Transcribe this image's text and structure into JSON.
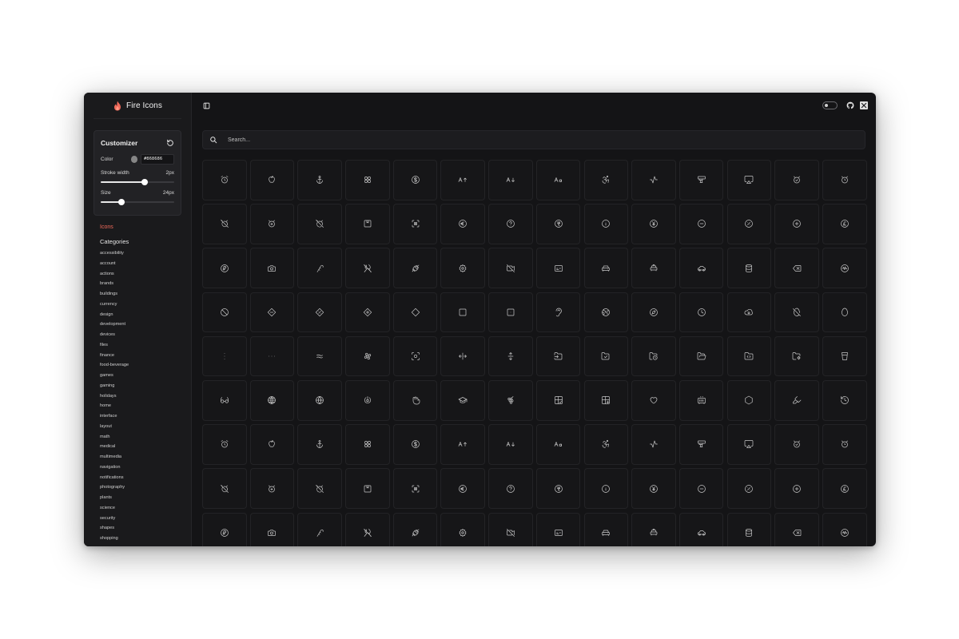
{
  "brand": {
    "name": "Fire Icons",
    "accent": "#f06a5b"
  },
  "customizer": {
    "title": "Customizer",
    "color_label": "Color",
    "color_value": "#868686",
    "stroke_label": "Stroke width",
    "stroke_value": "2px",
    "stroke_fraction": 0.6,
    "size_label": "Size",
    "size_value": "24px",
    "size_fraction": 0.28
  },
  "nav": {
    "icons_label": "Icons",
    "categories_label": "Categories",
    "categories": [
      "accessibility",
      "account",
      "actions",
      "brands",
      "buildings",
      "currency",
      "design",
      "development",
      "devices",
      "files",
      "finance",
      "food-beverage",
      "games",
      "gaming",
      "holidays",
      "home",
      "interface",
      "layout",
      "math",
      "medical",
      "multimedia",
      "navigation",
      "notifications",
      "photography",
      "plants",
      "science",
      "security",
      "shapes",
      "shopping"
    ]
  },
  "search": {
    "placeholder": "Search..."
  },
  "icon_rows": [
    [
      "alarm-clock-icon",
      "apple-icon",
      "anchor-icon",
      "four-circles-icon",
      "dollar-circle-icon",
      "a-arrow-up-icon",
      "a-arrow-down-icon",
      "a-lowercase-icon",
      "accessibility-icon",
      "activity-icon",
      "stamp-icon",
      "airplay-icon",
      "alarm-check-icon",
      "alarm-clock-alt-icon"
    ],
    [
      "alarm-off-icon",
      "alarm-plus-icon",
      "alarm-clock-off-icon",
      "square-bookmark-icon",
      "focus-icon",
      "euro-circle-icon",
      "help-circle-icon",
      "rupee-circle-icon",
      "info-circle-icon",
      "yen-circle-icon",
      "minus-circle-icon",
      "percent-circle-icon",
      "plus-circle-icon",
      "pound-circle-icon"
    ],
    [
      "ruble-circle-icon",
      "camera-icon",
      "candy-cane-icon",
      "cutlery-off-icon",
      "candy-icon",
      "sun-badge-icon",
      "video-off-icon",
      "card-icon",
      "car-front-icon",
      "car-taxi-icon",
      "car-side-icon",
      "database-icon",
      "delete-icon",
      "audio-circle-icon"
    ],
    [
      "ban-icon",
      "diamond-minus-icon",
      "diamond-percent-icon",
      "diamond-plus-icon",
      "diamond-icon",
      "square-icon",
      "square-dot-icon",
      "ear-icon",
      "globe-earth-icon",
      "compass-circle-icon",
      "clock-pie-icon",
      "cloud-disc-icon",
      "egg-off-icon",
      "egg-icon"
    ],
    [
      "ellipsis-vertical-icon",
      "ellipsis-icon",
      "equal-approximately-icon",
      "flower-icon",
      "scan-face-icon",
      "move-horizontal-icon",
      "move-vertical-icon",
      "folder-input-icon",
      "folder-check-icon",
      "folder-clock-icon",
      "folder-open-icon",
      "folder-code-icon",
      "folder-cog-icon",
      "cup-icon"
    ],
    [
      "glasses-icon",
      "globe-grid-icon",
      "globe-icon",
      "power-refresh-icon",
      "hand-grab-icon",
      "graduation-cap-icon",
      "grape-icon",
      "layout-check-icon",
      "layout-plus-icon",
      "heart-icon",
      "heater-icon",
      "hexagon-icon",
      "highlighter-icon",
      "history-icon"
    ],
    [
      "alarm-clock-icon",
      "apple-icon",
      "anchor-icon",
      "four-circles-icon",
      "dollar-circle-icon",
      "a-arrow-up-icon",
      "a-arrow-down-icon",
      "a-lowercase-icon",
      "accessibility-icon",
      "activity-icon",
      "stamp-icon",
      "airplay-icon",
      "alarm-check-icon",
      "alarm-clock-alt-icon"
    ],
    [
      "alarm-off-icon",
      "alarm-plus-icon",
      "alarm-clock-off-icon",
      "square-bookmark-icon",
      "focus-icon",
      "euro-circle-icon",
      "help-circle-icon",
      "rupee-circle-icon",
      "info-circle-icon",
      "yen-circle-icon",
      "minus-circle-icon",
      "percent-circle-icon",
      "plus-circle-icon",
      "pound-circle-icon"
    ],
    [
      "ruble-circle-icon",
      "camera-icon",
      "candy-cane-icon",
      "cutlery-off-icon",
      "candy-icon",
      "sun-badge-icon",
      "video-off-icon",
      "card-icon",
      "car-front-icon",
      "car-taxi-icon",
      "car-side-icon",
      "database-icon",
      "delete-icon",
      "audio-circle-icon"
    ]
  ]
}
